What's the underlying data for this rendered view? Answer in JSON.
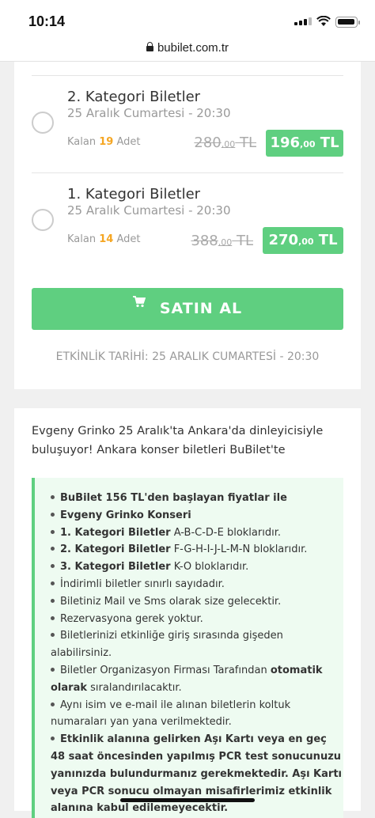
{
  "status": {
    "time": "10:14"
  },
  "browser": {
    "url": "bubilet.com.tr"
  },
  "tickets": [
    {
      "name": "2. Kategori Biletler",
      "date": "25 Aralık Cumartesi - 20:30",
      "left_prefix": "Kalan",
      "left_count": "19",
      "left_suffix": "Adet",
      "old_main": "280",
      "old_cents": ",00",
      "old_cur": " TL",
      "new_main": "196",
      "new_cents": ",00",
      "new_cur": " TL"
    },
    {
      "name": "1. Kategori Biletler",
      "date": "25 Aralık Cumartesi - 20:30",
      "left_prefix": "Kalan",
      "left_count": "14",
      "left_suffix": "Adet",
      "old_main": "388",
      "old_cents": ",00",
      "old_cur": " TL",
      "new_main": "270",
      "new_cents": ",00",
      "new_cur": " TL"
    }
  ],
  "buy_label": "SATIN AL",
  "event_date": "ETKİNLİK TARİHİ: 25 ARALIK CUMARTESİ - 20:30",
  "intro": "Evgeny Grinko 25 Aralık'ta Ankara'da dinleyicisiyle buluşuyor! Ankara konser biletleri BuBilet'te",
  "info": [
    {
      "bold": "BuBilet 156 TL'den başlayan fiyatlar ile",
      "text": ""
    },
    {
      "bold": "Evgeny Grinko Konseri",
      "text": ""
    },
    {
      "bold": "1. Kategori Biletler",
      "text": " A-B-C-D-E bloklarıdır."
    },
    {
      "bold": "2. Kategori Biletler",
      "text": " F-G-H-I-J-L-M-N bloklarıdır."
    },
    {
      "bold": "3. Kategori Biletler",
      "text": " K-O bloklarıdır."
    },
    {
      "bold": "",
      "text": "İndirimli biletler sınırlı sayıdadır."
    },
    {
      "bold": "",
      "text": "Biletiniz Mail ve Sms olarak size gelecektir."
    },
    {
      "bold": "",
      "text": "Rezervasyona gerek yoktur."
    },
    {
      "bold": "",
      "text": "Biletlerinizi etkinliğe giriş sırasında gişeden alabilirsiniz."
    },
    {
      "bold": "",
      "text": "Biletler Organizasyon Firması Tarafından ",
      "bold2": "otomatik olarak",
      "text2": " sıralandırılacaktır."
    },
    {
      "bold": "",
      "text": "Aynı isim ve e-mail ile alınan biletlerin koltuk numaraları yan yana verilmektedir."
    },
    {
      "bold": "Etkinlik alanına gelirken Aşı Kartı veya en geç 48 saat öncesinden yapılmış PCR test sonucunuzu yanınızda bulundurmanız gerekmektedir. Aşı Kartı veya PCR sonucu olmayan misafirlerimiz etkinlik alanına kabul edilemeyecektir.",
      "text": ""
    }
  ]
}
